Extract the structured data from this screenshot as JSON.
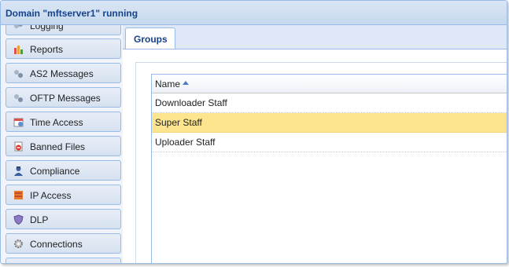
{
  "window": {
    "title": "Domain \"mftserver1\" running"
  },
  "sidebar": {
    "items": [
      {
        "label": "Logging",
        "icon": "logging-icon"
      },
      {
        "label": "Reports",
        "icon": "reports-icon"
      },
      {
        "label": "AS2 Messages",
        "icon": "as2-messages-icon"
      },
      {
        "label": "OFTP Messages",
        "icon": "oftp-messages-icon"
      },
      {
        "label": "Time Access",
        "icon": "time-access-icon"
      },
      {
        "label": "Banned Files",
        "icon": "banned-files-icon"
      },
      {
        "label": "Compliance",
        "icon": "compliance-icon"
      },
      {
        "label": "IP Access",
        "icon": "ip-access-icon"
      },
      {
        "label": "DLP",
        "icon": "dlp-icon"
      },
      {
        "label": "Connections",
        "icon": "connections-icon"
      }
    ]
  },
  "tabs": [
    {
      "label": "Groups",
      "active": true
    }
  ],
  "grid": {
    "column": "Name",
    "sort": "ascending",
    "rows": [
      {
        "name": "Downloader Staff",
        "selected": false
      },
      {
        "name": "Super Staff",
        "selected": true
      },
      {
        "name": "Uploader Staff",
        "selected": false
      }
    ]
  },
  "colors": {
    "accent": "#15428b",
    "border": "#99bbe8",
    "selection": "#fde58f"
  }
}
